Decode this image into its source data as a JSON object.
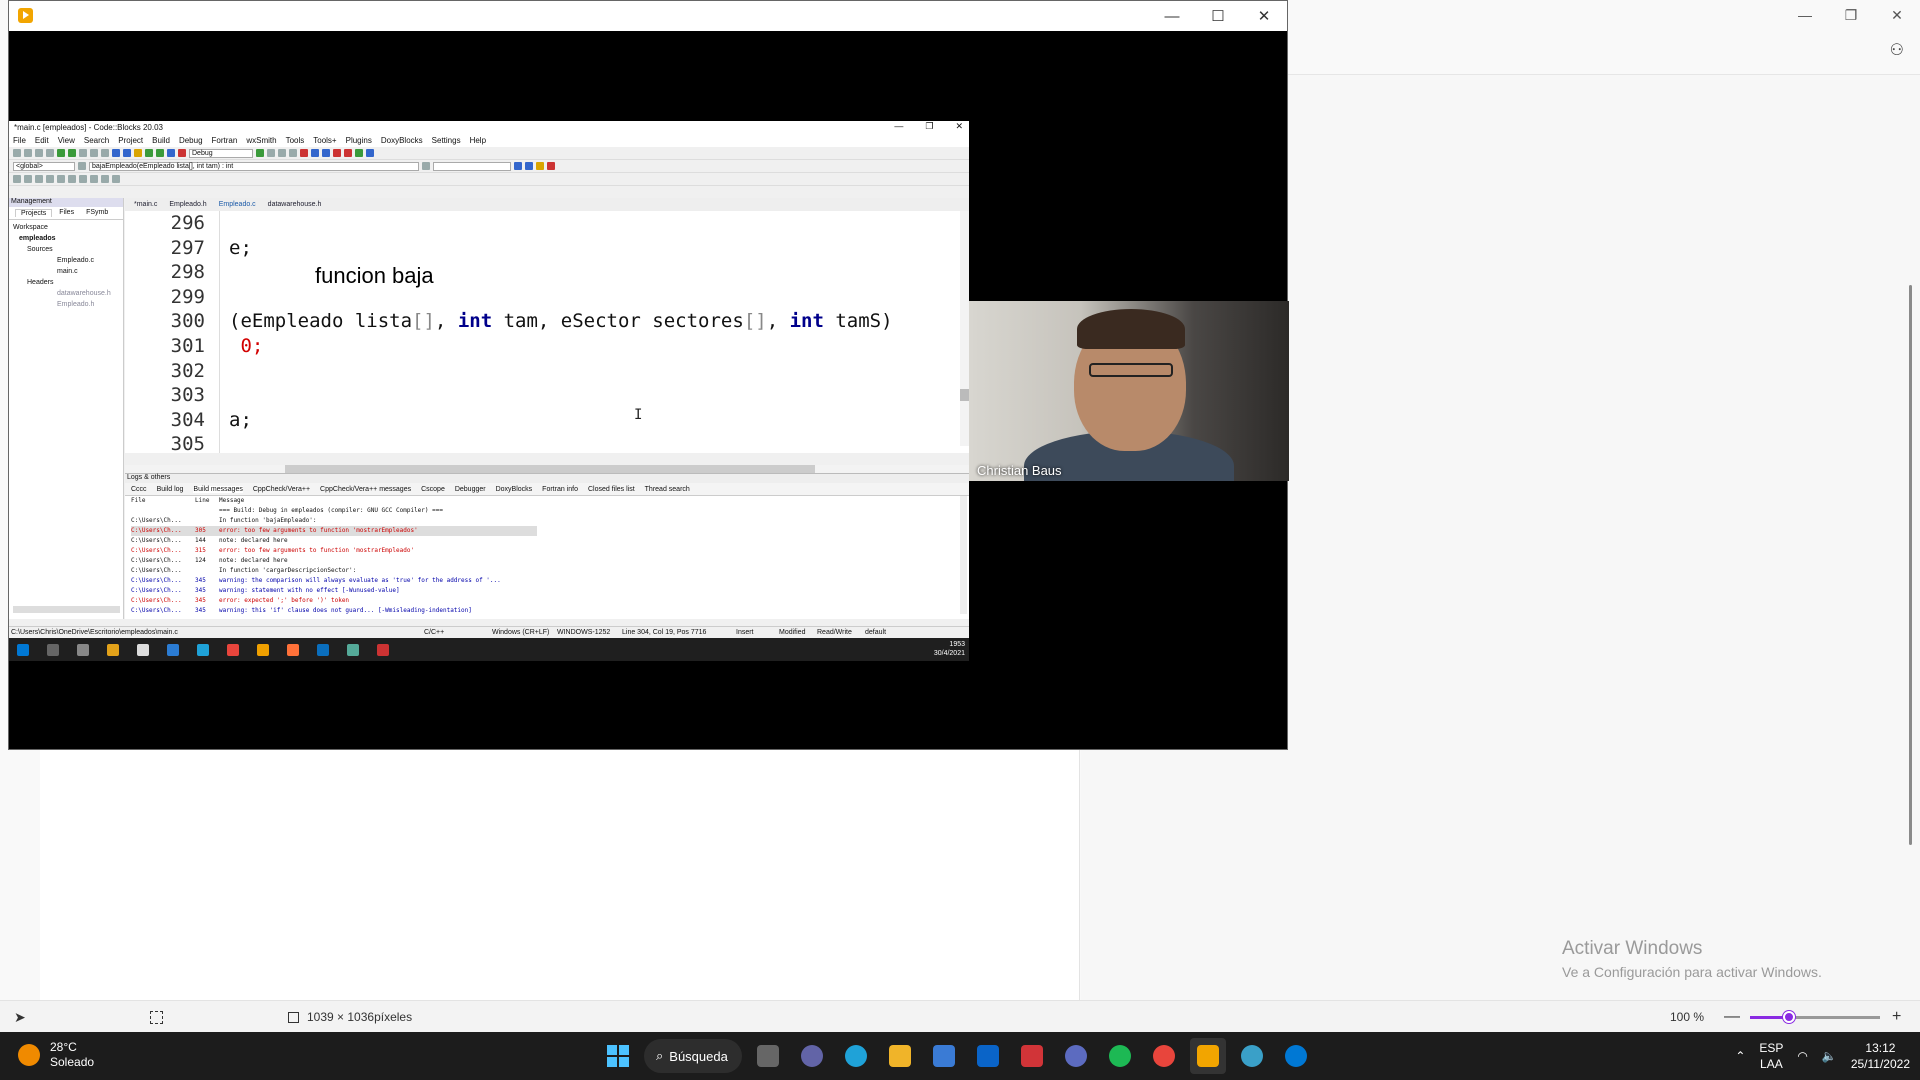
{
  "background_app": {
    "caption_buttons": [
      "—",
      "❐",
      "✕"
    ],
    "activate_windows": {
      "title": "Activar Windows",
      "subtitle": "Ve a Configuración para activar Windows."
    },
    "status": {
      "dimensions": "1039 × 1036píxeles",
      "zoom": "100 %",
      "zoom_minus": "—",
      "zoom_plus": "+",
      "zoom_level": 0.3
    }
  },
  "player": {
    "caption_buttons": [
      "—",
      "☐",
      "✕"
    ]
  },
  "codeblocks": {
    "title": "*main.c [empleados] - Code::Blocks 20.03",
    "window_buttons": [
      "—",
      "❐",
      "✕"
    ],
    "menu": [
      "File",
      "Edit",
      "View",
      "Search",
      "Project",
      "Build",
      "Debug",
      "Fortran",
      "wxSmith",
      "Tools",
      "Tools+",
      "Plugins",
      "DoxyBlocks",
      "Settings",
      "Help"
    ],
    "build_target": "Debug",
    "scope": "<global>",
    "function": "bajaEmpleado(eEmpleado lista[], int tam) : int",
    "management": {
      "header": "Management",
      "tabs": [
        "Projects",
        "Files",
        "FSymb"
      ],
      "tree": {
        "workspace": "Workspace",
        "project": "empleados",
        "sources": "Sources",
        "source_files": [
          "Empleado.c",
          "main.c"
        ],
        "headers": "Headers",
        "header_files": [
          "datawarehouse.h",
          "Empleado.h"
        ]
      }
    },
    "editor_tabs": [
      "*main.c",
      "Empleado.h",
      "Empleado.c",
      "datawarehouse.h"
    ],
    "line_numbers": [
      "296",
      "297",
      "298",
      "299",
      "300",
      "301",
      "302",
      "303",
      "304",
      "305"
    ],
    "code_lines": {
      "l297": "e;",
      "l300_open": "(eEmpleado lista",
      "l300_p1": "[]",
      "l300_c1": ", ",
      "l300_kw1": "int",
      "l300_mid": " tam, eSector sectores",
      "l300_p2": "[]",
      "l300_c2": ", ",
      "l300_kw2": "int",
      "l300_end": " tamS)",
      "l301": "0",
      "l301_end": ";",
      "l304": "a;"
    },
    "overlay_caption": "funcion baja",
    "logs": {
      "header": "Logs & others",
      "tabs": [
        "Cccc",
        "Build log",
        "Build messages",
        "CppCheck/Vera++",
        "CppCheck/Vera++ messages",
        "Cscope",
        "Debugger",
        "DoxyBlocks",
        "Fortran info",
        "Closed files list",
        "Thread search"
      ],
      "columns": [
        "File",
        "Line",
        "Message"
      ],
      "rows": [
        {
          "file": "",
          "line": "",
          "msg": "=== Build: Debug in empleados (compiler: GNU GCC Compiler) ===",
          "kind": "normal"
        },
        {
          "file": "C:\\Users\\Ch...",
          "line": "",
          "msg": "In function 'bajaEmpleado':",
          "kind": "normal"
        },
        {
          "file": "C:\\Users\\Ch...",
          "line": "305",
          "msg": "error: too few arguments to function 'mostrarEmpleados'",
          "kind": "sel"
        },
        {
          "file": "C:\\Users\\Ch...",
          "line": "144",
          "msg": "note: declared here",
          "kind": "normal"
        },
        {
          "file": "C:\\Users\\Ch...",
          "line": "315",
          "msg": "error: too few arguments to function 'mostrarEmpleado'",
          "kind": "err"
        },
        {
          "file": "C:\\Users\\Ch...",
          "line": "124",
          "msg": "note: declared here",
          "kind": "normal"
        },
        {
          "file": "C:\\Users\\Ch...",
          "line": "",
          "msg": "In function 'cargarDescripcionSector':",
          "kind": "normal"
        },
        {
          "file": "C:\\Users\\Ch...",
          "line": "345",
          "msg": "warning: the comparison will always evaluate as 'true' for the address of '...",
          "kind": "warn"
        },
        {
          "file": "C:\\Users\\Ch...",
          "line": "345",
          "msg": "warning: statement with no effect [-Wunused-value]",
          "kind": "warn"
        },
        {
          "file": "C:\\Users\\Ch...",
          "line": "345",
          "msg": "error: expected ';' before ')' token",
          "kind": "err"
        },
        {
          "file": "C:\\Users\\Ch...",
          "line": "345",
          "msg": "warning: this 'if' clause does not guard... [-Wmisleading-indentation]",
          "kind": "warn"
        }
      ]
    },
    "status": {
      "path": "C:\\Users\\Chris\\OneDrive\\Escritorio\\empleados\\main.c",
      "lang": "C/C++",
      "eol": "Windows (CR+LF)",
      "encoding": "WINDOWS-1252",
      "position": "Line 304, Col 19, Pos 7716",
      "mode": "Insert",
      "modified": "Modified",
      "access": "Read/Write",
      "profile": "default"
    },
    "inner_taskbar": {
      "time": "1953",
      "date": "30/4/2021"
    }
  },
  "webcam": {
    "name": "Christian Baus"
  },
  "taskbar": {
    "weather": {
      "temp": "28°C",
      "condition": "Soleado"
    },
    "search_label": "Búsqueda",
    "lang_top": "ESP",
    "lang_bottom": "LAA",
    "time": "13:12",
    "date": "25/11/2022"
  }
}
